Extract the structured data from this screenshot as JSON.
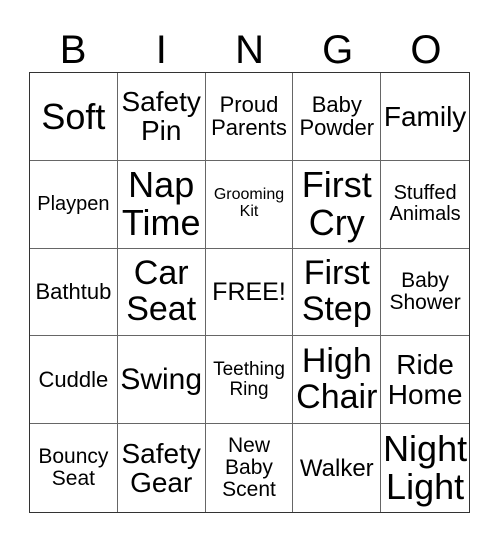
{
  "header": {
    "letters": [
      "B",
      "I",
      "N",
      "G",
      "O"
    ]
  },
  "cells": [
    "Soft",
    "Safety\nPin",
    "Proud\nParents",
    "Baby\nPowder",
    "Family",
    "Playpen",
    "Nap\nTime",
    "Grooming\nKit",
    "First\nCry",
    "Stuffed\nAnimals",
    "Bathtub",
    "Car\nSeat",
    "FREE!",
    "First\nStep",
    "Baby\nShower",
    "Cuddle",
    "Swing",
    "Teething\nRing",
    "High\nChair",
    "Ride\nHome",
    "Bouncy\nSeat",
    "Safety\nGear",
    "New\nBaby\nScent",
    "Walker",
    "Night\nLight"
  ],
  "free_space_index": 12
}
